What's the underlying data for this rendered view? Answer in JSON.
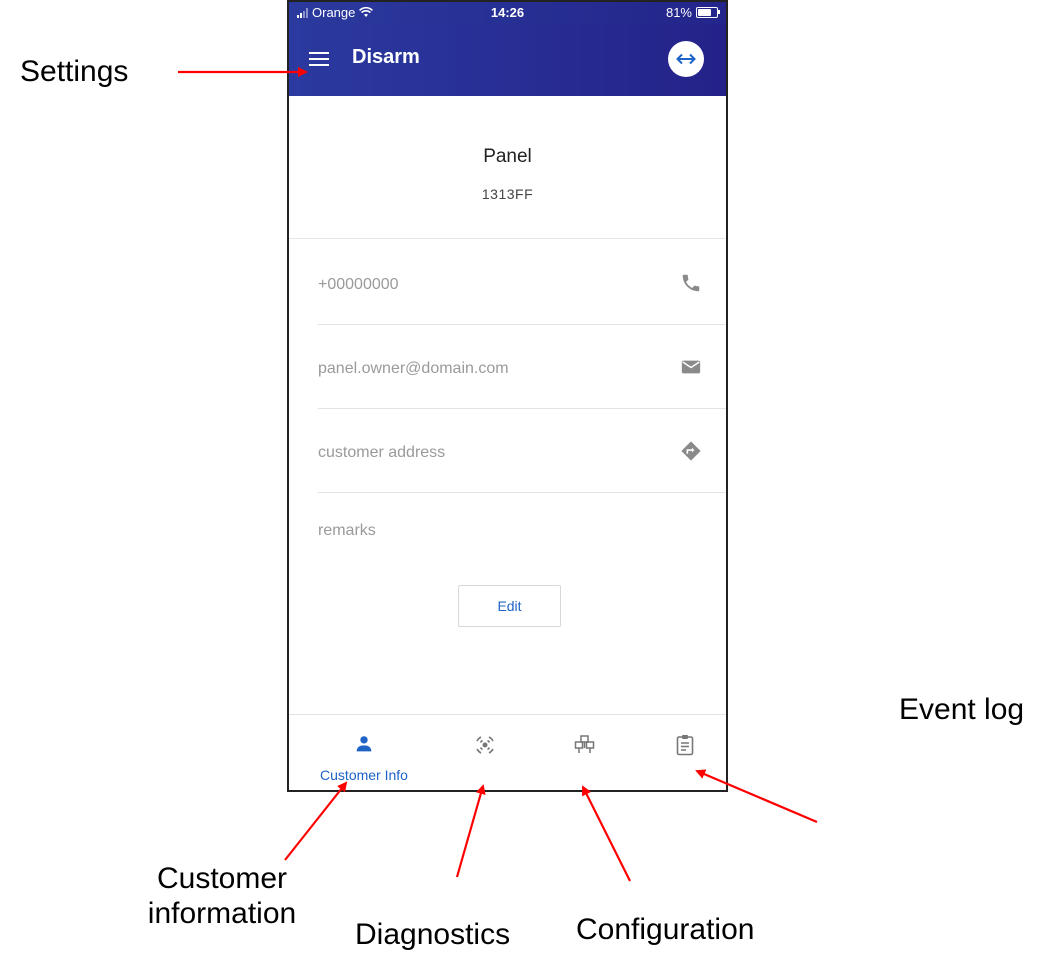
{
  "annotations": {
    "settings": "Settings",
    "event_log": "Event log",
    "customer_information": [
      "Customer",
      "information"
    ],
    "diagnostics": "Diagnostics",
    "configuration": "Configuration"
  },
  "status_bar": {
    "carrier": "Orange",
    "time": "14:26",
    "battery": "81%"
  },
  "app_bar": {
    "title": "Disarm",
    "menu_icon": "hamburger-menu-icon",
    "action_icon": "swap-horizontal-icon"
  },
  "panel": {
    "name": "Panel",
    "id": "1313FF"
  },
  "fields": {
    "phone": {
      "value": "+00000000",
      "icon": "phone-icon"
    },
    "email": {
      "value": "panel.owner@domain.com",
      "icon": "mail-icon"
    },
    "address": {
      "value": "customer address",
      "icon": "directions-icon"
    },
    "remarks": "remarks"
  },
  "edit_label": "Edit",
  "bottom_nav": [
    {
      "id": "customer-info",
      "label": "Customer Info",
      "icon": "person-icon",
      "active": true
    },
    {
      "id": "diagnostics",
      "label": "",
      "icon": "diagnostics-icon",
      "active": false
    },
    {
      "id": "configuration",
      "label": "",
      "icon": "network-config-icon",
      "active": false
    },
    {
      "id": "event-log",
      "label": "",
      "icon": "clipboard-icon",
      "active": false
    }
  ],
  "colors": {
    "app_bar": "#2a30a0",
    "accent": "#1f63c6",
    "muted_text": "#9a9a9a",
    "icon_gray": "#8a8a8a",
    "annotation_arrow": "#ff0000"
  }
}
